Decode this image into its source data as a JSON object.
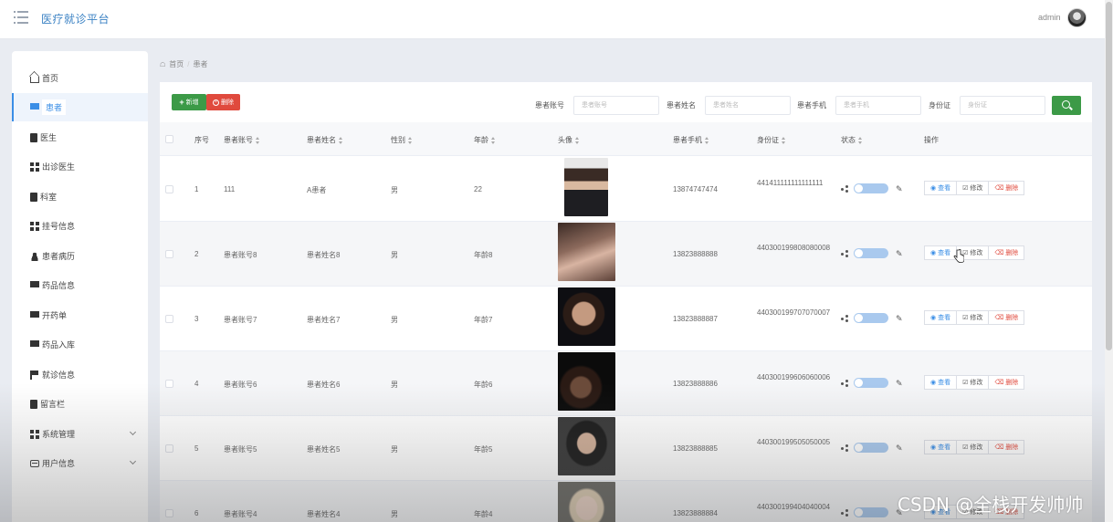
{
  "header": {
    "title": "医疗就诊平台",
    "user": "admin"
  },
  "sidebar": {
    "items": [
      {
        "label": "首页",
        "icon": "home-icon"
      },
      {
        "label": "患者",
        "icon": "monitor-icon",
        "active": true
      },
      {
        "label": "医生",
        "icon": "clipboard-icon"
      },
      {
        "label": "出诊医生",
        "icon": "grid-icon"
      },
      {
        "label": "科室",
        "icon": "clipboard-icon"
      },
      {
        "label": "挂号信息",
        "icon": "grid-icon"
      },
      {
        "label": "患者病历",
        "icon": "user-icon"
      },
      {
        "label": "药品信息",
        "icon": "monitor-icon"
      },
      {
        "label": "开药单",
        "icon": "folder-icon"
      },
      {
        "label": "药品入库",
        "icon": "chat-icon"
      },
      {
        "label": "就诊信息",
        "icon": "flag-icon"
      },
      {
        "label": "留言栏",
        "icon": "book-icon"
      },
      {
        "label": "系统管理",
        "icon": "grid-icon",
        "expandable": true
      },
      {
        "label": "用户信息",
        "icon": "card-icon",
        "expandable": true
      }
    ]
  },
  "breadcrumb": {
    "home": "首页",
    "current": "患者"
  },
  "toolbar": {
    "add_label": "新增",
    "delete_label": "删除"
  },
  "search": {
    "account_label": "患者账号",
    "account_placeholder": "患者账号",
    "name_label": "患者姓名",
    "name_placeholder": "患者姓名",
    "phone_label": "患者手机",
    "phone_placeholder": "患者手机",
    "idcard_label": "身份证",
    "idcard_placeholder": "身份证"
  },
  "table": {
    "columns": [
      "序号",
      "患者账号",
      "患者姓名",
      "性别",
      "年龄",
      "头像",
      "患者手机",
      "身份证",
      "状态",
      "操作"
    ],
    "actions": {
      "view": "查看",
      "edit": "修改",
      "delete": "删除"
    },
    "rows": [
      {
        "index": "1",
        "account": "111",
        "name": "A患者",
        "gender": "男",
        "age": "22",
        "phone": "13874747474",
        "idcard": "441411111111111111"
      },
      {
        "index": "2",
        "account": "患者账号8",
        "name": "患者姓名8",
        "gender": "男",
        "age": "年龄8",
        "phone": "13823888888",
        "idcard": "440300199808080008"
      },
      {
        "index": "3",
        "account": "患者账号7",
        "name": "患者姓名7",
        "gender": "男",
        "age": "年龄7",
        "phone": "13823888887",
        "idcard": "440300199707070007"
      },
      {
        "index": "4",
        "account": "患者账号6",
        "name": "患者姓名6",
        "gender": "男",
        "age": "年龄6",
        "phone": "13823888886",
        "idcard": "440300199606060006"
      },
      {
        "index": "5",
        "account": "患者账号5",
        "name": "患者姓名5",
        "gender": "男",
        "age": "年龄5",
        "phone": "13823888885",
        "idcard": "440300199505050005"
      },
      {
        "index": "6",
        "account": "患者账号4",
        "name": "患者姓名4",
        "gender": "男",
        "age": "年龄4",
        "phone": "13823888884",
        "idcard": "440300199404040004"
      }
    ]
  },
  "watermark": "CSDN @全栈开发帅帅"
}
